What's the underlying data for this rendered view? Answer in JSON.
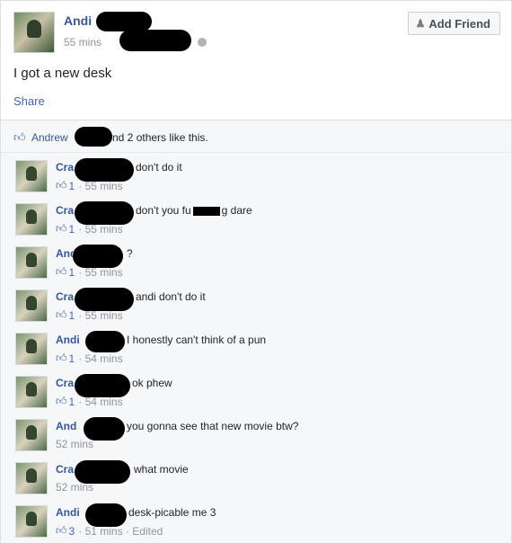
{
  "post": {
    "author": "Andi",
    "time": "55 mins",
    "text": "I got a new desk",
    "share_label": "Share",
    "add_friend_label": "Add Friend",
    "add_friend_icon": "add-friend-icon"
  },
  "likes": {
    "who": "Andrew",
    "rest": "nd 2 others like this.",
    "icon": "thumbs-up-icon"
  },
  "comments": [
    {
      "name": "Cra",
      "text": "don't do it",
      "likes": "1",
      "time": "55 mins"
    },
    {
      "name": "Cra",
      "text_before": "don't you fu",
      "text_after": "g dare",
      "likes": "1",
      "time": "55 mins"
    },
    {
      "name": "And",
      "text": "?",
      "likes": "1",
      "time": "55 mins"
    },
    {
      "name": "Cra",
      "text": "andi don't do it",
      "likes": "1",
      "time": "55 mins"
    },
    {
      "name": "Andi",
      "text": "I honestly can't think of a pun",
      "likes": "1",
      "time": "54 mins"
    },
    {
      "name": "Cra",
      "text": "ok phew",
      "likes": "1",
      "time": "54 mins"
    },
    {
      "name": "And",
      "text": "you gonna see that new movie btw?",
      "likes": "",
      "time": "52 mins"
    },
    {
      "name": "Cra",
      "text": "what movie",
      "likes": "",
      "time": "52 mins"
    },
    {
      "name": "Andi",
      "text": "desk-picable me 3",
      "likes": "3",
      "time": "51 mins",
      "edited": "Edited"
    }
  ]
}
